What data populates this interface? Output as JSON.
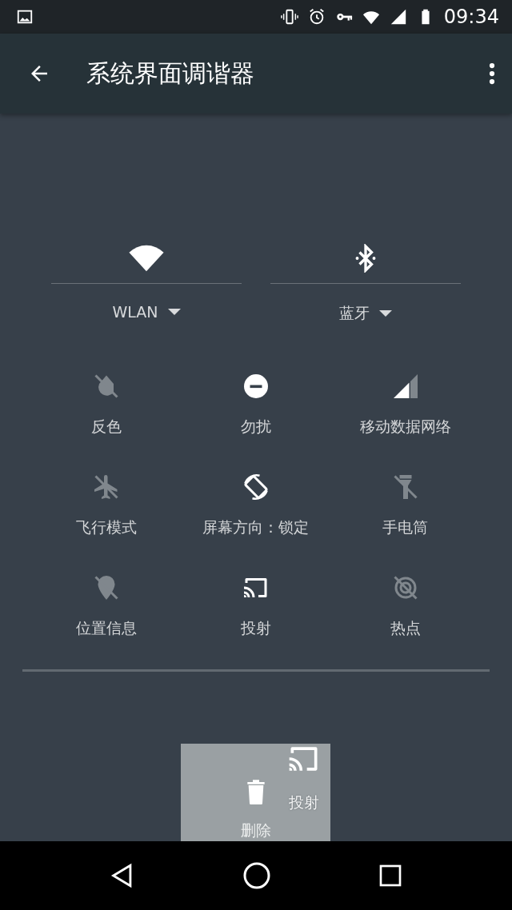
{
  "status_bar": {
    "time": "09:34"
  },
  "app_bar": {
    "title": "系统界面调谐器"
  },
  "big_tiles": [
    {
      "label": "WLAN",
      "on": true
    },
    {
      "label": "蓝牙",
      "on": true
    }
  ],
  "tiles": [
    {
      "label": "反色",
      "on": false
    },
    {
      "label": "勿扰",
      "on": true
    },
    {
      "label": "移动数据网络",
      "on": true
    },
    {
      "label": "飞行模式",
      "on": false
    },
    {
      "label": "屏幕方向：锁定",
      "on": true
    },
    {
      "label": "手电筒",
      "on": false
    },
    {
      "label": "位置信息",
      "on": false
    },
    {
      "label": "投射",
      "on": true
    },
    {
      "label": "热点",
      "on": false
    }
  ],
  "drop_zone": {
    "label": "删除"
  },
  "dragged_tile": {
    "label": "投射"
  }
}
